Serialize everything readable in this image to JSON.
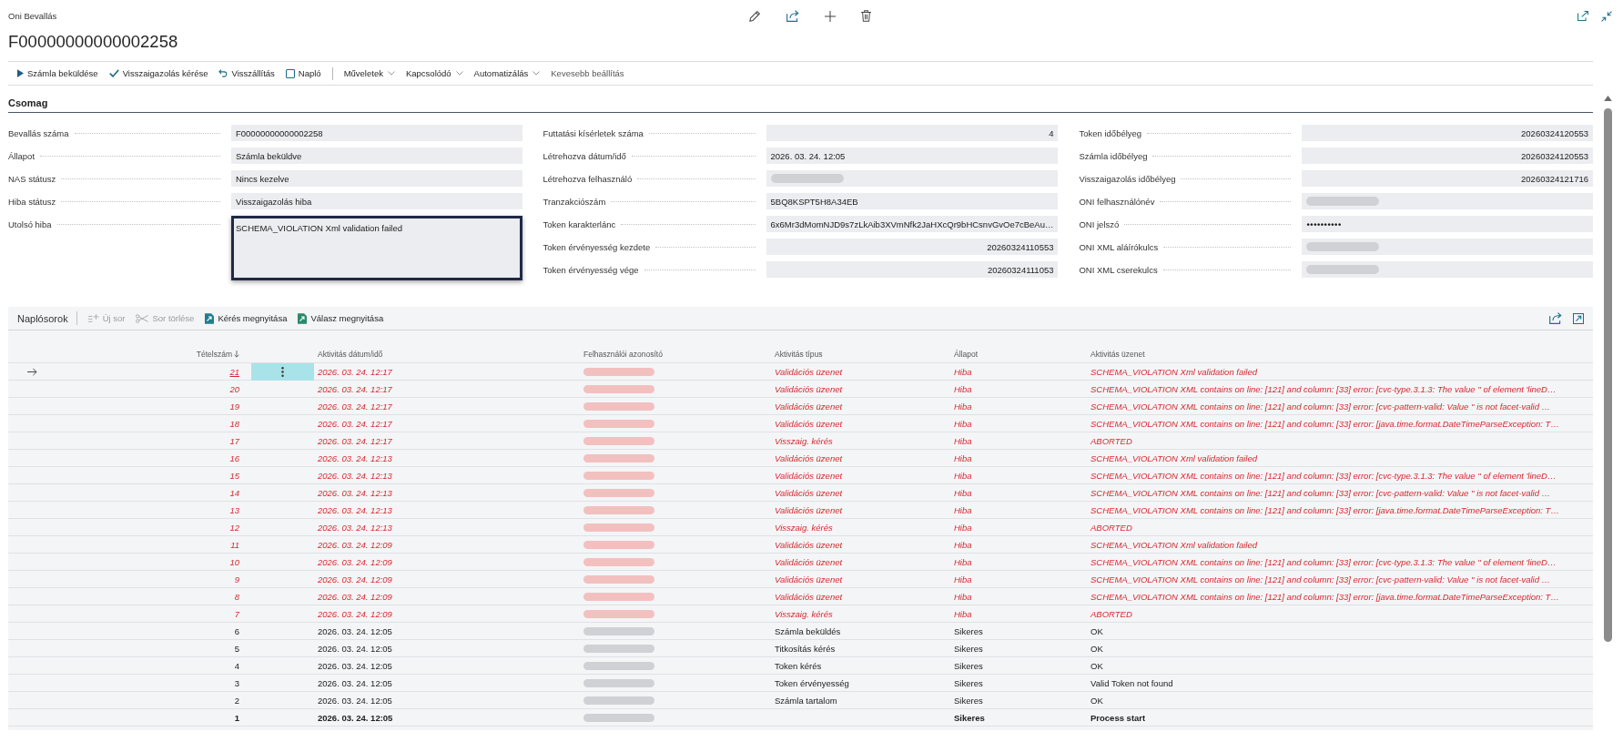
{
  "page": {
    "caption": "Oni Bevallás",
    "title": "F00000000000002258"
  },
  "action_bar": [
    {
      "kind": "action",
      "label": "Számla beküldése"
    },
    {
      "kind": "action",
      "label": "Visszaigazolás kérése"
    },
    {
      "kind": "action",
      "label": "Visszállítás"
    },
    {
      "kind": "action",
      "label": "Napló"
    },
    {
      "kind": "separator"
    },
    {
      "kind": "menu",
      "label": "Műveletek"
    },
    {
      "kind": "menu",
      "label": "Kapcsolódó"
    },
    {
      "kind": "menu",
      "label": "Automatizálás"
    },
    {
      "kind": "plain",
      "label": "Kevesebb beállítás"
    }
  ],
  "section": {
    "title": "Csomag",
    "columns": [
      [
        {
          "label": "Bevallás száma",
          "kind": "text",
          "value": "F00000000000002258",
          "focused": false
        },
        {
          "label": "Állapot",
          "kind": "text",
          "value": "Számla beküldve",
          "focused": false
        },
        {
          "label": "NAS státusz",
          "kind": "text",
          "value": "Nincs kezelve",
          "focused": false
        },
        {
          "label": "Hiba státusz",
          "kind": "text",
          "value": "Visszaigazolás hiba",
          "focused": false
        },
        {
          "label": "Utolsó hiba",
          "kind": "multiline",
          "value": "SCHEMA_VIOLATION Xml validation failed",
          "focused": true
        }
      ],
      [
        {
          "label": "Futtatási kísérletek száma",
          "kind": "number",
          "value": "4",
          "focused": false
        },
        {
          "label": "Létrehozva dátum/idő",
          "kind": "text",
          "value": "2026. 03. 24. 12:05",
          "focused": false
        },
        {
          "label": "Létrehozva felhasználó",
          "kind": "redacted",
          "focused": false
        },
        {
          "label": "Tranzakciószám",
          "kind": "text",
          "value": "5BQ8KSPT5H8A34EB",
          "focused": false
        },
        {
          "label": "Token karakterlánc",
          "kind": "text",
          "value": "6x6Mr3dMomNJD9s7zLkAib3XVmNfk2JaHXcQr9bHCsnvGvOe7cBeAu…",
          "focused": false
        },
        {
          "label": "Token érvényesség kezdete",
          "kind": "number",
          "value": "20260324110553",
          "focused": false
        },
        {
          "label": "Token érvényesség vége",
          "kind": "number",
          "value": "20260324111053",
          "focused": false
        }
      ],
      [
        {
          "label": "Token időbélyeg",
          "kind": "number",
          "value": "20260324120553",
          "focused": false
        },
        {
          "label": "Számla időbélyeg",
          "kind": "number",
          "value": "20260324120553",
          "focused": false
        },
        {
          "label": "Visszaigazolás időbélyeg",
          "kind": "number",
          "value": "20260324121716",
          "focused": false
        },
        {
          "label": "ONI felhasználónév",
          "kind": "redacted",
          "focused": false
        },
        {
          "label": "ONI jelszó",
          "kind": "password",
          "value": "••••••••••",
          "focused": false
        },
        {
          "label": "ONI XML aláírókulcs",
          "kind": "redacted",
          "focused": false
        },
        {
          "label": "ONI XML cserekulcs",
          "kind": "redacted",
          "focused": false
        }
      ]
    ]
  },
  "lines": {
    "title": "Naplósorok",
    "actions": [
      {
        "label": "Új sor",
        "disabled": true
      },
      {
        "label": "Sor törlése",
        "disabled": true
      },
      {
        "label": "Kérés megnyitása",
        "disabled": false
      },
      {
        "label": "Válasz megnyitása",
        "disabled": false
      }
    ],
    "columns": [
      {
        "label": "Tételszám",
        "sorted": true
      },
      {
        "label": "Aktivitás dátum/idő",
        "sorted": false
      },
      {
        "label": "Felhasználói azonosító",
        "sorted": false
      },
      {
        "label": "Aktivitás típus",
        "sorted": false
      },
      {
        "label": "Állapot",
        "sorted": false
      },
      {
        "label": "Aktivitás üzenet",
        "sorted": false
      }
    ],
    "rows": [
      {
        "selected": true,
        "kind": "error",
        "number": "21",
        "datetime": "2026. 03. 24. 12:17",
        "user_redacted": true,
        "type": "Validációs üzenet",
        "status": "Hiba",
        "message": "SCHEMA_VIOLATION Xml validation failed"
      },
      {
        "selected": false,
        "kind": "error",
        "number": "20",
        "datetime": "2026. 03. 24. 12:17",
        "user_redacted": true,
        "type": "Validációs üzenet",
        "status": "Hiba",
        "message": "SCHEMA_VIOLATION XML contains on line: [121] and column: [33] error: [cvc-type.3.1.3: The value '' of element 'lineD…"
      },
      {
        "selected": false,
        "kind": "error",
        "number": "19",
        "datetime": "2026. 03. 24. 12:17",
        "user_redacted": true,
        "type": "Validációs üzenet",
        "status": "Hiba",
        "message": "SCHEMA_VIOLATION XML contains on line: [121] and column: [33] error: [cvc-pattern-valid: Value '' is not facet-valid …"
      },
      {
        "selected": false,
        "kind": "error",
        "number": "18",
        "datetime": "2026. 03. 24. 12:17",
        "user_redacted": true,
        "type": "Validációs üzenet",
        "status": "Hiba",
        "message": "SCHEMA_VIOLATION XML contains on line: [121] and column: [33] error: [java.time.format.DateTimeParseException: T…"
      },
      {
        "selected": false,
        "kind": "error",
        "number": "17",
        "datetime": "2026. 03. 24. 12:17",
        "user_redacted": true,
        "type": "Visszaig. kérés",
        "status": "Hiba",
        "message": "ABORTED"
      },
      {
        "selected": false,
        "kind": "error",
        "number": "16",
        "datetime": "2026. 03. 24. 12:13",
        "user_redacted": true,
        "type": "Validációs üzenet",
        "status": "Hiba",
        "message": "SCHEMA_VIOLATION Xml validation failed"
      },
      {
        "selected": false,
        "kind": "error",
        "number": "15",
        "datetime": "2026. 03. 24. 12:13",
        "user_redacted": true,
        "type": "Validációs üzenet",
        "status": "Hiba",
        "message": "SCHEMA_VIOLATION XML contains on line: [121] and column: [33] error: [cvc-type.3.1.3: The value '' of element 'lineD…"
      },
      {
        "selected": false,
        "kind": "error",
        "number": "14",
        "datetime": "2026. 03. 24. 12:13",
        "user_redacted": true,
        "type": "Validációs üzenet",
        "status": "Hiba",
        "message": "SCHEMA_VIOLATION XML contains on line: [121] and column: [33] error: [cvc-pattern-valid: Value '' is not facet-valid …"
      },
      {
        "selected": false,
        "kind": "error",
        "number": "13",
        "datetime": "2026. 03. 24. 12:13",
        "user_redacted": true,
        "type": "Validációs üzenet",
        "status": "Hiba",
        "message": "SCHEMA_VIOLATION XML contains on line: [121] and column: [33] error: [java.time.format.DateTimeParseException: T…"
      },
      {
        "selected": false,
        "kind": "error",
        "number": "12",
        "datetime": "2026. 03. 24. 12:13",
        "user_redacted": true,
        "type": "Visszaig. kérés",
        "status": "Hiba",
        "message": "ABORTED"
      },
      {
        "selected": false,
        "kind": "error",
        "number": "11",
        "datetime": "2026. 03. 24. 12:09",
        "user_redacted": true,
        "type": "Validációs üzenet",
        "status": "Hiba",
        "message": "SCHEMA_VIOLATION Xml validation failed"
      },
      {
        "selected": false,
        "kind": "error",
        "number": "10",
        "datetime": "2026. 03. 24. 12:09",
        "user_redacted": true,
        "type": "Validációs üzenet",
        "status": "Hiba",
        "message": "SCHEMA_VIOLATION XML contains on line: [121] and column: [33] error: [cvc-type.3.1.3: The value '' of element 'lineD…"
      },
      {
        "selected": false,
        "kind": "error",
        "number": "9",
        "datetime": "2026. 03. 24. 12:09",
        "user_redacted": true,
        "type": "Validációs üzenet",
        "status": "Hiba",
        "message": "SCHEMA_VIOLATION XML contains on line: [121] and column: [33] error: [cvc-pattern-valid: Value '' is not facet-valid …"
      },
      {
        "selected": false,
        "kind": "error",
        "number": "8",
        "datetime": "2026. 03. 24. 12:09",
        "user_redacted": true,
        "type": "Validációs üzenet",
        "status": "Hiba",
        "message": "SCHEMA_VIOLATION XML contains on line: [121] and column: [33] error: [java.time.format.DateTimeParseException: T…"
      },
      {
        "selected": false,
        "kind": "error",
        "number": "7",
        "datetime": "2026. 03. 24. 12:09",
        "user_redacted": true,
        "type": "Visszaig. kérés",
        "status": "Hiba",
        "message": "ABORTED"
      },
      {
        "selected": false,
        "kind": "normal",
        "number": "6",
        "datetime": "2026. 03. 24. 12:05",
        "user_redacted": true,
        "type": "Számla beküldés",
        "status": "Sikeres",
        "message": "OK"
      },
      {
        "selected": false,
        "kind": "normal",
        "number": "5",
        "datetime": "2026. 03. 24. 12:05",
        "user_redacted": true,
        "type": "Titkosítás kérés",
        "status": "Sikeres",
        "message": "OK"
      },
      {
        "selected": false,
        "kind": "normal",
        "number": "4",
        "datetime": "2026. 03. 24. 12:05",
        "user_redacted": true,
        "type": "Token kérés",
        "status": "Sikeres",
        "message": "OK"
      },
      {
        "selected": false,
        "kind": "normal",
        "number": "3",
        "datetime": "2026. 03. 24. 12:05",
        "user_redacted": true,
        "type": "Token érvényesség",
        "status": "Sikeres",
        "message": "Valid Token not found"
      },
      {
        "selected": false,
        "kind": "normal",
        "number": "2",
        "datetime": "2026. 03. 24. 12:05",
        "user_redacted": true,
        "type": "Számla tartalom",
        "status": "Sikeres",
        "message": "OK"
      },
      {
        "selected": false,
        "kind": "strong",
        "number": "1",
        "datetime": "2026. 03. 24. 12:05",
        "user_redacted": true,
        "status": "Sikeres",
        "message": "Process start"
      }
    ]
  }
}
